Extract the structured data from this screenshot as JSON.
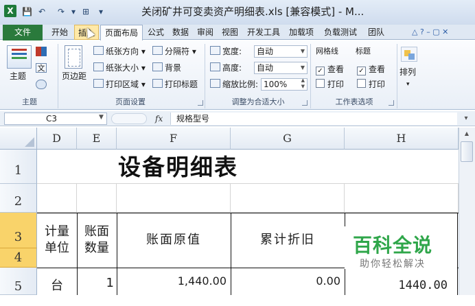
{
  "window": {
    "app_letter": "X",
    "title": "关闭矿井可变卖资产明细表.xls  [兼容模式] - M...",
    "min": "–",
    "restore": "□",
    "close": "✕"
  },
  "qat": {
    "save": "💾",
    "undo": "↶",
    "redo": "↷",
    "extra1": "▾",
    "extra2": "⊞",
    "extra3": "▾"
  },
  "tabs": {
    "file": "文件",
    "items": [
      "开始",
      "插入",
      "页面布局",
      "公式",
      "数据",
      "审阅",
      "视图",
      "开发工具",
      "加载项",
      "负载测试",
      "团队"
    ],
    "right_icons": "△ ? – ▢ ✕"
  },
  "ribbon": {
    "theme": {
      "label": "主题",
      "group": "主题"
    },
    "page_setup": {
      "margins": "页边距",
      "orientation": "纸张方向",
      "size": "纸张大小",
      "print_area": "打印区域",
      "breaks": "分隔符",
      "background": "背景",
      "print_titles": "打印标题",
      "group": "页面设置"
    },
    "scale": {
      "width_label": "宽度:",
      "width_value": "自动",
      "height_label": "高度:",
      "height_value": "自动",
      "zoom_label": "缩放比例:",
      "zoom_value": "100%",
      "group": "调整为合适大小"
    },
    "sheet_options": {
      "gridlines": "网格线",
      "headings": "标题",
      "view": "查看",
      "print": "打印",
      "group": "工作表选项"
    },
    "arrange": {
      "label": "排列"
    }
  },
  "formula_bar": {
    "name_box": "C3",
    "fx": "fx",
    "value": "规格型号"
  },
  "grid": {
    "columns": [
      "D",
      "E",
      "F",
      "G",
      "H"
    ],
    "rows": [
      "1",
      "2",
      "3",
      "4",
      "5"
    ],
    "title": "设备明细表",
    "headers": {
      "unit": "计量单位",
      "qty": "账面数量",
      "orig": "账面原值",
      "depr": "累计折旧"
    },
    "row5": {
      "unit": "台",
      "qty": "1",
      "orig": "1,440.00",
      "depr": "0.00",
      "h": "1440.00"
    }
  },
  "watermark": {
    "title": "百科全说",
    "sub": "助你轻松解决"
  }
}
